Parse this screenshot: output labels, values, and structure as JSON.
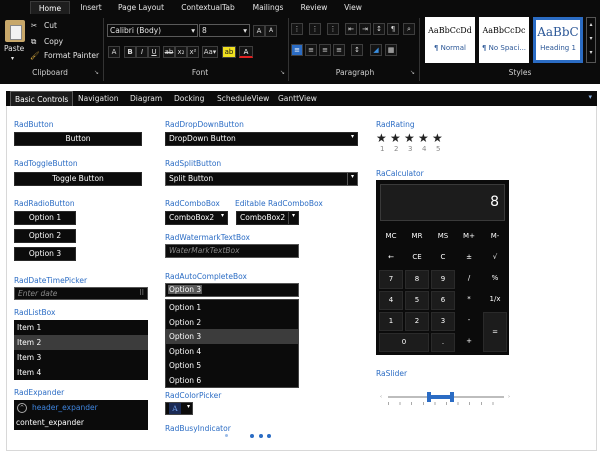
{
  "ribbon": {
    "tabs": [
      "Home",
      "Insert",
      "Page Layout",
      "ContextualTab",
      "Mailings",
      "Review",
      "View"
    ],
    "clipboard": {
      "paste": "Paste",
      "cut": "Cut",
      "copy": "Copy",
      "format_painter": "Format Painter",
      "group": "Clipboard"
    },
    "font": {
      "family": "Calibri (Body)",
      "size": "8",
      "group": "Font"
    },
    "paragraph": {
      "group": "Paragraph"
    },
    "styles": {
      "group": "Styles",
      "tiles": [
        {
          "sample": "AaBbCcDd",
          "name": "¶ Normal"
        },
        {
          "sample": "AaBbCcDc",
          "name": "¶ No Spaci..."
        },
        {
          "sample": "AaBbC",
          "name": "Heading 1"
        }
      ]
    },
    "colors": {
      "accent": "#2b6cc4"
    }
  },
  "tabstrip": {
    "tabs": [
      "Basic Controls",
      "Navigation",
      "Diagram",
      "Docking",
      "ScheduleView",
      "GanttView"
    ],
    "pin_icon": "pin-icon"
  },
  "left": {
    "radbutton": {
      "label": "RadButton",
      "text": "Button"
    },
    "radtoggle": {
      "label": "RadToggleButton",
      "text": "Toggle Button"
    },
    "radradio": {
      "label": "RadRadioButton",
      "options": [
        "Option 1",
        "Option 2",
        "Option 3"
      ]
    },
    "raddate": {
      "label": "RadDateTimePicker",
      "placeholder": "Enter date"
    },
    "radlistbox": {
      "label": "RadListBox",
      "items": [
        "Item 1",
        "Item 2",
        "Item 3",
        "Item 4"
      ],
      "selected": "Item 2"
    },
    "radexpander": {
      "label": "RadExpander",
      "header": "header_expander",
      "content": "content_expander"
    }
  },
  "middle": {
    "dropdown": {
      "label": "RadDropDownButton",
      "text": "DropDown Button"
    },
    "split": {
      "label": "RadSplitButton",
      "text": "Split Button"
    },
    "combo": {
      "label": "RadComboBox",
      "value": "ComboBox2"
    },
    "editcombo": {
      "label": "Editable RadComboBox",
      "value": "ComboBox2"
    },
    "watermark": {
      "label": "RadWatermarkTextBox",
      "placeholder": "WaterMarkTextBox"
    },
    "autocomplete": {
      "label": "RadAutoCompleteBox",
      "value": "Option 3",
      "options": [
        "Option 1",
        "Option 2",
        "Option 3",
        "Option 4",
        "Option 5",
        "Option 6"
      ],
      "selected": "Option 3"
    },
    "colorpicker": {
      "label": "RadColorPicker",
      "glyph": "A"
    },
    "busy": {
      "label": "RadBusyIndicator"
    }
  },
  "right": {
    "rating": {
      "label": "RadRating",
      "value": 5,
      "max": 5,
      "numbers": [
        "1",
        "2",
        "3",
        "4",
        "5"
      ]
    },
    "calculator": {
      "label": "RaCalculator",
      "display": "8",
      "rows": [
        [
          "MC",
          "MR",
          "MS",
          "M+",
          "M-"
        ],
        [
          "←",
          "CE",
          "C",
          "±",
          "√"
        ],
        [
          "7",
          "8",
          "9",
          "/",
          "%"
        ],
        [
          "4",
          "5",
          "6",
          "*",
          "1/x"
        ],
        [
          "1",
          "2",
          "3",
          "-",
          "="
        ],
        [
          "0",
          ".",
          "+"
        ]
      ]
    },
    "slider": {
      "label": "RaSlider",
      "range_start": 0.35,
      "range_end": 0.55
    }
  }
}
